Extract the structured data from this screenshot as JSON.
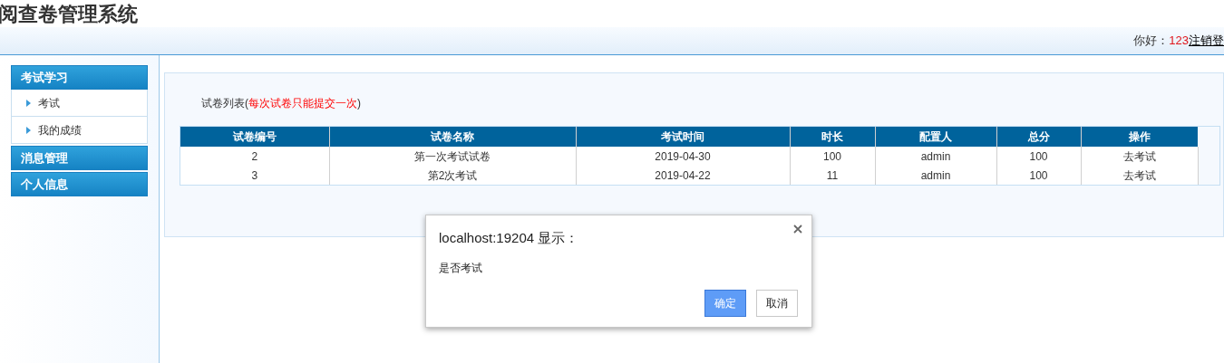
{
  "header": {
    "title": "阅查卷管理系统",
    "greeting": "你好：",
    "user": "123",
    "logout": "注销登"
  },
  "sidebar": {
    "groups": [
      {
        "title": "考试学习",
        "items": [
          {
            "label": "考试"
          },
          {
            "label": "我的成绩"
          }
        ]
      },
      {
        "title": "消息管理"
      },
      {
        "title": "个人信息"
      }
    ]
  },
  "list": {
    "caption": "试卷列表(",
    "note": "每次试卷只能提交一次",
    "caption_end": ")"
  },
  "table": {
    "columns": [
      "试卷编号",
      "试卷名称",
      "考试时间",
      "时长",
      "配置人",
      "总分",
      "操作"
    ],
    "rows": [
      [
        "2",
        "第一次考试试卷",
        "2019-04-30",
        "100",
        "admin",
        "100",
        "去考试"
      ],
      [
        "3",
        "第2次考试",
        "2019-04-22",
        "11",
        "admin",
        "100",
        "去考试"
      ]
    ]
  },
  "dialog": {
    "title": "localhost:19204 显示：",
    "message": "是否考试",
    "buttons": [
      {
        "label": "确定",
        "kind": "primary"
      },
      {
        "label": "取消",
        "kind": "secondary"
      }
    ]
  }
}
